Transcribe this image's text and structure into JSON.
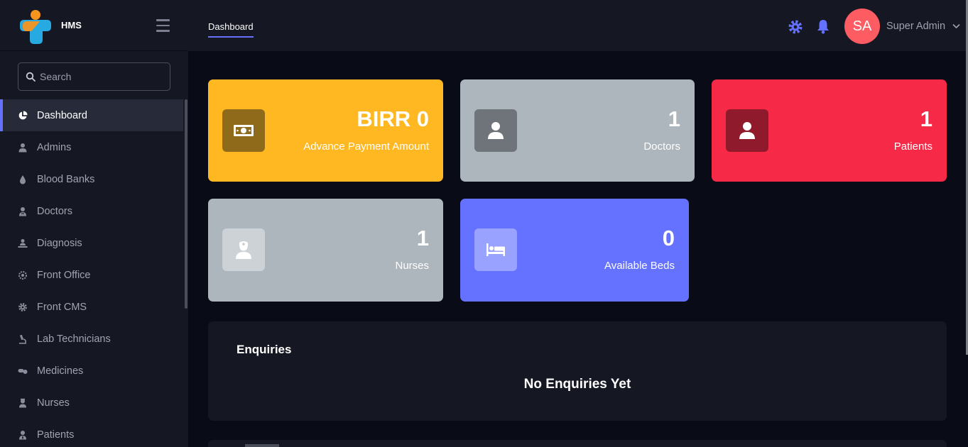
{
  "brand": {
    "name": "HMS"
  },
  "search": {
    "placeholder": "Search"
  },
  "sidebar": {
    "items": [
      {
        "label": "Dashboard",
        "icon": "pie-chart-icon",
        "active": true
      },
      {
        "label": "Admins",
        "icon": "user-icon"
      },
      {
        "label": "Blood Banks",
        "icon": "droplet-icon"
      },
      {
        "label": "Doctors",
        "icon": "doctor-icon"
      },
      {
        "label": "Diagnosis",
        "icon": "diagnosis-icon"
      },
      {
        "label": "Front Office",
        "icon": "front-office-icon"
      },
      {
        "label": "Front CMS",
        "icon": "gear-icon"
      },
      {
        "label": "Lab Technicians",
        "icon": "microscope-icon"
      },
      {
        "label": "Medicines",
        "icon": "pills-icon"
      },
      {
        "label": "Nurses",
        "icon": "nurse-icon"
      },
      {
        "label": "Patients",
        "icon": "patient-icon"
      }
    ]
  },
  "header": {
    "tab": "Dashboard",
    "avatar_initials": "SA",
    "user_name": "Super Admin"
  },
  "cards": [
    {
      "value": "BIRR 0",
      "label": "Advance Payment Amount",
      "color": "#ffb821",
      "icon_bg": "#8e6a1a",
      "icon": "money-icon"
    },
    {
      "value": "1",
      "label": "Doctors",
      "color": "#adb5bd",
      "icon_bg": "#6e747a",
      "icon": "user-icon"
    },
    {
      "value": "1",
      "label": "Patients",
      "color": "#f62947",
      "icon_bg": "#8e1a2c",
      "icon": "user-icon"
    },
    {
      "value": "1",
      "label": "Nurses",
      "color": "#adb5bd",
      "icon_bg": "#cdd2d6",
      "icon": "nurse-icon"
    },
    {
      "value": "0",
      "label": "Available Beds",
      "color": "#6571ff",
      "icon_bg": "#9aa2ff",
      "icon": "bed-icon"
    }
  ],
  "enquiries": {
    "title": "Enquiries",
    "empty_text": "No Enquiries Yet"
  },
  "colors": {
    "accent": "#6571ff",
    "avatar": "#fc5c62"
  }
}
